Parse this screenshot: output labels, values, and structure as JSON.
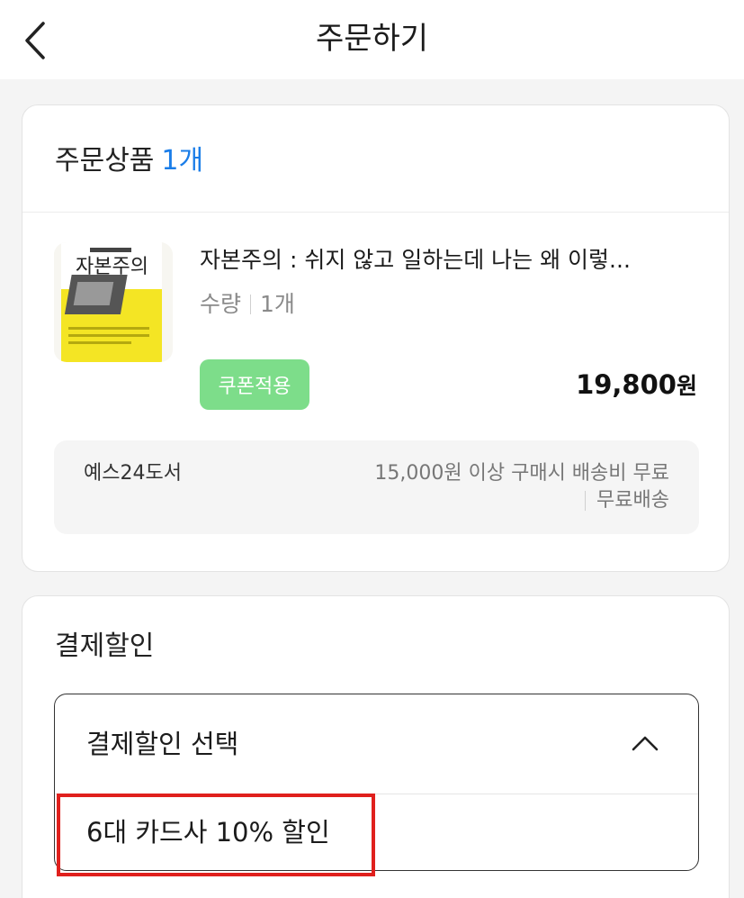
{
  "header": {
    "title": "주문하기",
    "back_icon": "chevron-left-icon"
  },
  "order": {
    "section_title": "주문상품",
    "count_label": "1개",
    "product": {
      "name": "자본주의 : 쉬지 않고 일하는데 나는 왜 이렇...",
      "qty_label": "수량",
      "qty_value": "1개",
      "coupon_button": "쿠폰적용",
      "price_number": "19,800",
      "price_unit": "원",
      "cover_title": "자본주의",
      "cover_colors": {
        "top": "#ffffff",
        "bottom": "#f4e524"
      }
    },
    "shipping": {
      "seller": "예스24도서",
      "line1": "15,000원 이상 구매시 배송비 무료",
      "line2": "무료배송"
    }
  },
  "discount": {
    "section_title": "결제할인",
    "select_label": "결제할인 선택",
    "chevron_icon": "chevron-up-icon",
    "options": [
      {
        "label": "6대 카드사 10% 할인"
      }
    ]
  },
  "colors": {
    "accent": "#1a7de8",
    "coupon": "#7ddd8a",
    "highlight": "#e0201d",
    "background": "#f4f4f4"
  }
}
